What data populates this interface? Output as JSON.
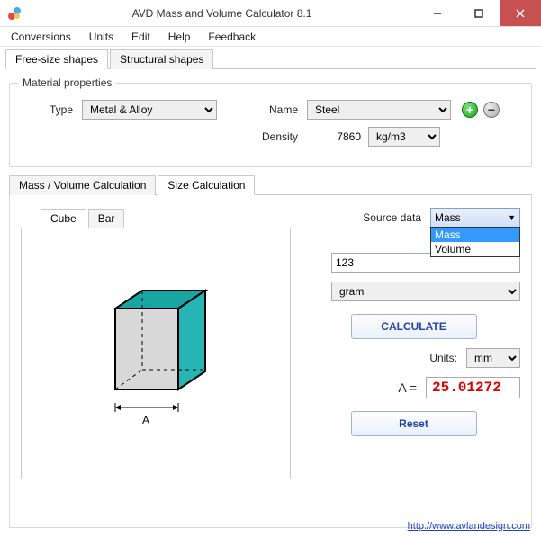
{
  "window": {
    "title": "AVD Mass and Volume Calculator 8.1"
  },
  "menu": {
    "items": [
      "Conversions",
      "Units",
      "Edit",
      "Help",
      "Feedback"
    ]
  },
  "outer_tabs": {
    "items": [
      "Free-size shapes",
      "Structural shapes"
    ],
    "active": 0
  },
  "material": {
    "legend": "Material properties",
    "type_label": "Type",
    "type_value": "Metal & Alloy",
    "name_label": "Name",
    "name_value": "Steel",
    "density_label": "Density",
    "density_value": "7860",
    "density_unit": "kg/m3"
  },
  "inner_tabs": {
    "items": [
      "Mass / Volume  Calculation",
      "Size  Calculation"
    ],
    "active": 1
  },
  "shape_tabs": {
    "items": [
      "Cube",
      "Bar"
    ],
    "active": 0
  },
  "shape_label": "A",
  "calc": {
    "source_label": "Source data",
    "source_value": "Mass",
    "source_options": [
      "Mass",
      "Volume"
    ],
    "input_value": "123",
    "input_unit": "gram",
    "calculate_btn": "CALCULATE",
    "units_label": "Units:",
    "units_value": "mm",
    "result_label": "A =",
    "result_value": "25.01272",
    "reset_btn": "Reset"
  },
  "footer": {
    "link": "http://www.avlandesign.com"
  }
}
